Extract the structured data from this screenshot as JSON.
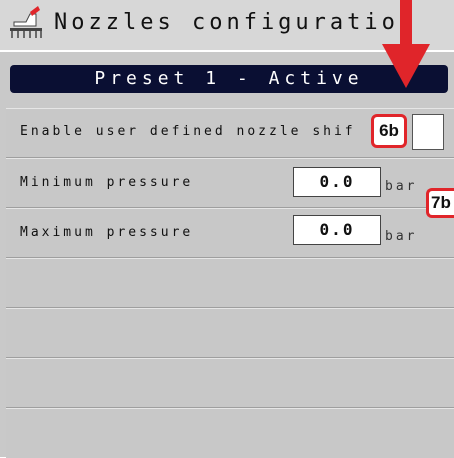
{
  "header": {
    "title": "Nozzles configuration",
    "icon": "sprayer-boom-icon"
  },
  "preset": {
    "label": "Preset 1 - Active"
  },
  "settings": {
    "nozzle_shift": {
      "label": "Enable user defined nozzle shif",
      "checked": false
    },
    "minimum_pressure": {
      "label": "Minimum pressure",
      "value": "0.0",
      "unit": "bar"
    },
    "maximum_pressure": {
      "label": "Maximum pressure",
      "value": "0.0",
      "unit": "bar"
    }
  },
  "annotations": {
    "badge_6b": "6b",
    "badge_7b": "7b"
  },
  "colors": {
    "accent_red": "#e0252a",
    "preset_bar": "#0a0f33"
  }
}
